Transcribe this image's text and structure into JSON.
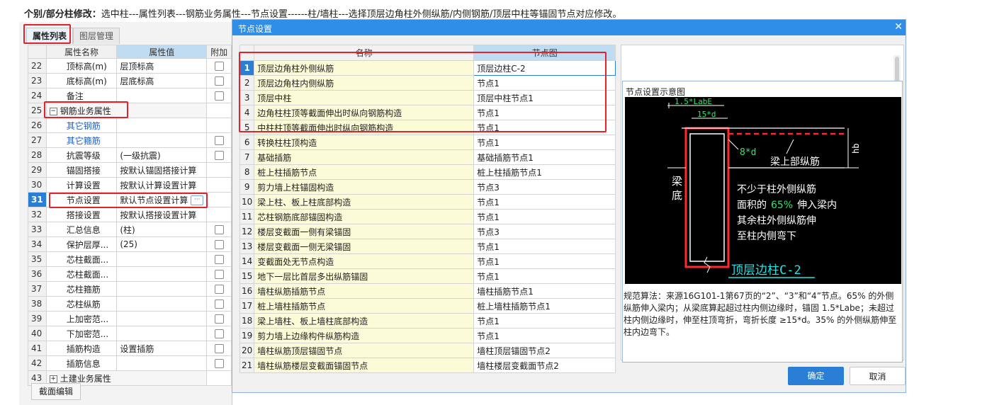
{
  "instruction": {
    "label": "个别/部分柱修改：",
    "text": "选中柱---属性列表---钢筋业务属性---节点设置------柱/墙柱---选择顶层边角柱外侧纵筋/内侧钢筋/顶层中柱等锚固节点对应修改。"
  },
  "left_panel": {
    "tabs": [
      "属性列表",
      "图层管理"
    ],
    "columns": [
      "属性名称",
      "属性值",
      "附加"
    ],
    "rows": [
      {
        "num": "22",
        "name": "顶标高(m)",
        "value": "层顶标高",
        "check": true
      },
      {
        "num": "23",
        "name": "底标高(m)",
        "value": "层底标高",
        "check": true
      },
      {
        "num": "24",
        "name": "备注",
        "value": "",
        "check": true
      },
      {
        "num": "25",
        "name": "钢筋业务属性",
        "value": "",
        "check": false,
        "group": true
      },
      {
        "num": "26",
        "name": "其它钢筋",
        "value": "",
        "check": false,
        "blue": true
      },
      {
        "num": "27",
        "name": "其它箍筋",
        "value": "",
        "check": true,
        "blue": true
      },
      {
        "num": "28",
        "name": "抗震等级",
        "value": "(一级抗震)",
        "check": true
      },
      {
        "num": "29",
        "name": "锚固搭接",
        "value": "按默认锚固搭接计算",
        "check": false
      },
      {
        "num": "30",
        "name": "计算设置",
        "value": "按默认计算设置计算",
        "check": false
      },
      {
        "num": "31",
        "name": "节点设置",
        "value": "默认节点设置计算",
        "check": false,
        "selected": true
      },
      {
        "num": "32",
        "name": "搭接设置",
        "value": "按默认搭接设置计算",
        "check": false
      },
      {
        "num": "33",
        "name": "汇总信息",
        "value": "(柱)",
        "check": true
      },
      {
        "num": "34",
        "name": "保护层厚...",
        "value": "(25)",
        "check": true
      },
      {
        "num": "35",
        "name": "芯柱截面...",
        "value": "",
        "check": true
      },
      {
        "num": "36",
        "name": "芯柱截面...",
        "value": "",
        "check": true
      },
      {
        "num": "37",
        "name": "芯柱箍筋",
        "value": "",
        "check": true
      },
      {
        "num": "38",
        "name": "芯柱纵筋",
        "value": "",
        "check": true
      },
      {
        "num": "39",
        "name": "上加密范...",
        "value": "",
        "check": true
      },
      {
        "num": "40",
        "name": "下加密范...",
        "value": "",
        "check": true
      },
      {
        "num": "41",
        "name": "插筋构造",
        "value": "设置插筋",
        "check": true
      },
      {
        "num": "42",
        "name": "插筋信息",
        "value": "",
        "check": true
      },
      {
        "num": "43",
        "name": "土建业务属性",
        "value": "",
        "check": false,
        "group": true
      }
    ],
    "bottom_tab": "截面编辑"
  },
  "dialog": {
    "title": "节点设置",
    "columns": [
      "名称",
      "节点图"
    ],
    "rows": [
      {
        "num": "1",
        "name": "顶层边角柱外侧纵筋",
        "node": "顶层边柱C-2",
        "selected": true
      },
      {
        "num": "2",
        "name": "顶层边角柱内侧纵筋",
        "node": "节点1"
      },
      {
        "num": "3",
        "name": "顶层中柱",
        "node": "顶层中柱节点1"
      },
      {
        "num": "4",
        "name": "边角柱柱顶等截面伸出时纵向钢筋构造",
        "node": "节点1"
      },
      {
        "num": "5",
        "name": "中柱柱顶等截面伸出时纵向钢筋构造",
        "node": "节点1"
      },
      {
        "num": "6",
        "name": "转换柱柱顶构造",
        "node": "节点1"
      },
      {
        "num": "7",
        "name": "基础插筋",
        "node": "基础插筋节点1"
      },
      {
        "num": "8",
        "name": "桩上柱插筋节点",
        "node": "桩上柱插筋节点1"
      },
      {
        "num": "9",
        "name": "剪力墙上柱锚固构造",
        "node": "节点3"
      },
      {
        "num": "10",
        "name": "梁上柱、板上柱底部构造",
        "node": "节点1"
      },
      {
        "num": "11",
        "name": "芯柱钢筋底部锚固构造",
        "node": "节点1"
      },
      {
        "num": "12",
        "name": "楼层变截面一侧有梁锚固",
        "node": "节点3"
      },
      {
        "num": "13",
        "name": "楼层变截面一侧无梁锚固",
        "node": "节点1"
      },
      {
        "num": "14",
        "name": "变截面处无节点构造",
        "node": "节点1"
      },
      {
        "num": "15",
        "name": "地下一层比首层多出纵筋锚固",
        "node": "节点1"
      },
      {
        "num": "16",
        "name": "墙柱纵筋插筋节点",
        "node": "墙柱插筋节点1"
      },
      {
        "num": "17",
        "name": "桩上墙柱插筋节点",
        "node": "桩上墙柱插筋节点1"
      },
      {
        "num": "18",
        "name": "梁上墙柱、板上墙柱底部构造",
        "node": "节点1"
      },
      {
        "num": "19",
        "name": "剪力墙上边缘构件纵筋构造",
        "node": "节点1"
      },
      {
        "num": "20",
        "name": "墙柱纵筋顶层锚固节点",
        "node": "墙柱顶层锚固节点2"
      },
      {
        "num": "21",
        "name": "墙柱纵筋楼层变截面锚固节点",
        "node": "墙柱楼层变截面节点2"
      }
    ],
    "diagram": {
      "title": "节点设置示意图",
      "labels": {
        "dim1": "1.5*LabE",
        "dim2": "15*d",
        "dim3": "8*d",
        "beam_bars": "梁上部纵筋",
        "hb": "hb",
        "beam_bottom_1": "梁",
        "beam_bottom_2": "底",
        "note1": "不少于柱外侧纵筋",
        "note2a": "面积的",
        "note2b": "65%",
        "note2c": "伸入梁内",
        "note3": "其余柱外侧纵筋伸",
        "note4": "至柱内侧弯下",
        "caption": "顶层边柱C-2"
      },
      "algorithm": "规范算法：来源16G101-1第67页的“2”、“3”和“4”节点。65% 的外侧纵筋伸入梁内；从梁底算起超过柱内侧边缘时，锚固 1.5*Labe；未超过柱内侧边缘时，伸至柱顶弯折，弯折长度 ≥15*d。35% 的外侧纵筋伸至柱内边弯下。"
    },
    "ok": "确定",
    "cancel": "取消"
  },
  "colors": {
    "accent": "#2a7fd4",
    "highlight_red": "#e3232b",
    "name_cell_bg": "#fcfbd8"
  }
}
